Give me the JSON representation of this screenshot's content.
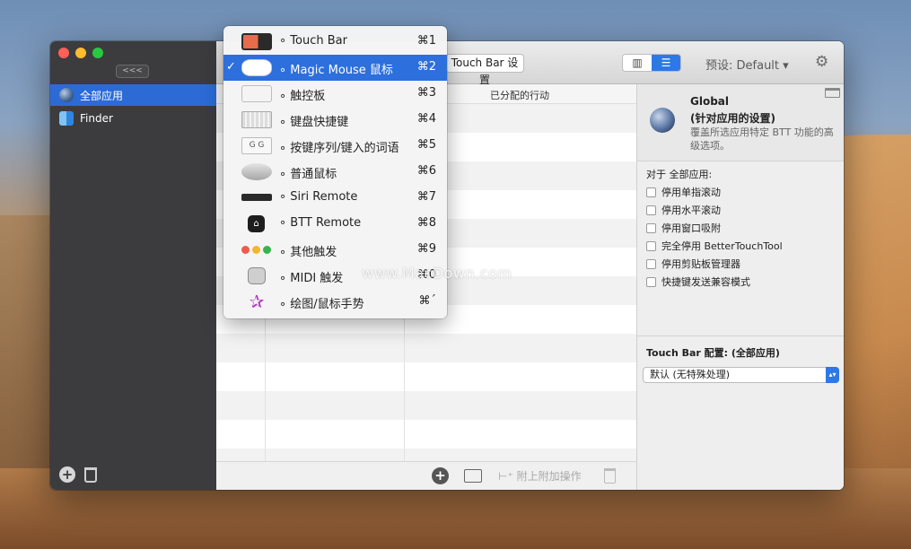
{
  "sidebar": {
    "collapse_label": "<<<",
    "items": [
      {
        "label": "全部应用",
        "icon": "globe-icon",
        "selected": true
      },
      {
        "label": "Finder",
        "icon": "finder-icon",
        "selected": false
      }
    ]
  },
  "toolbar": {
    "touchbar_button": "Touch Bar 设置",
    "view_mode": {
      "options": [
        "grid",
        "list"
      ],
      "selected": "list"
    },
    "preset_label": "预设: Default ▾",
    "settings_icon": "gear-icon"
  },
  "table": {
    "header_action": "已分配的行动",
    "row_count": 13
  },
  "bottombar": {
    "attach_label": "附上附加操作"
  },
  "right_panel": {
    "title": "Global",
    "subtitle": "(针对应用的设置)",
    "description": "覆盖所选应用特定 BTT 功能的高级选项。",
    "section_label": "对于 全部应用:",
    "checkboxes": [
      {
        "label": "停用单指滚动",
        "checked": false
      },
      {
        "label": "停用水平滚动",
        "checked": false
      },
      {
        "label": "停用窗口吸附",
        "checked": false
      },
      {
        "label": "完全停用 BetterTouchTool",
        "checked": false
      },
      {
        "label": "停用剪贴板管理器",
        "checked": false
      },
      {
        "label": "快捷键发送兼容模式",
        "checked": false
      }
    ],
    "touchbar_config_label": "Touch Bar 配置: (全部应用)",
    "touchbar_select_value": "默认 (无特殊处理)"
  },
  "dropdown_menu": {
    "items": [
      {
        "label": "∘ Touch Bar",
        "shortcut": "⌘1",
        "icon": "touchbar-icon",
        "checked": false
      },
      {
        "label": "∘ Magic Mouse 鼠标",
        "shortcut": "⌘2",
        "icon": "magic-mouse-icon",
        "checked": true
      },
      {
        "label": "∘ 触控板",
        "shortcut": "⌘3",
        "icon": "trackpad-icon",
        "checked": false
      },
      {
        "label": "∘ 键盘快捷键",
        "shortcut": "⌘4",
        "icon": "keyboard-icon",
        "checked": false
      },
      {
        "label": "∘ 按键序列/键入的词语",
        "shortcut": "⌘5",
        "icon": "key-sequence-icon",
        "checked": false
      },
      {
        "label": "∘ 普通鼠标",
        "shortcut": "⌘6",
        "icon": "mouse-icon",
        "checked": false
      },
      {
        "label": "∘ Siri Remote",
        "shortcut": "⌘7",
        "icon": "siri-remote-icon",
        "checked": false
      },
      {
        "label": "∘ BTT Remote",
        "shortcut": "⌘8",
        "icon": "btt-remote-icon",
        "checked": false
      },
      {
        "label": "∘ 其他触发",
        "shortcut": "⌘9",
        "icon": "other-triggers-icon",
        "checked": false
      },
      {
        "label": "∘ MIDI 触发",
        "shortcut": "⌘0",
        "icon": "midi-icon",
        "checked": false
      },
      {
        "label": "∘ 绘图/鼠标手势",
        "shortcut": "⌘´",
        "icon": "drawing-icon",
        "checked": false
      }
    ]
  },
  "watermark": "www.MacDown.com",
  "colors": {
    "accent": "#2d6fdc",
    "sidebar_bg": "#3c3c3e"
  }
}
